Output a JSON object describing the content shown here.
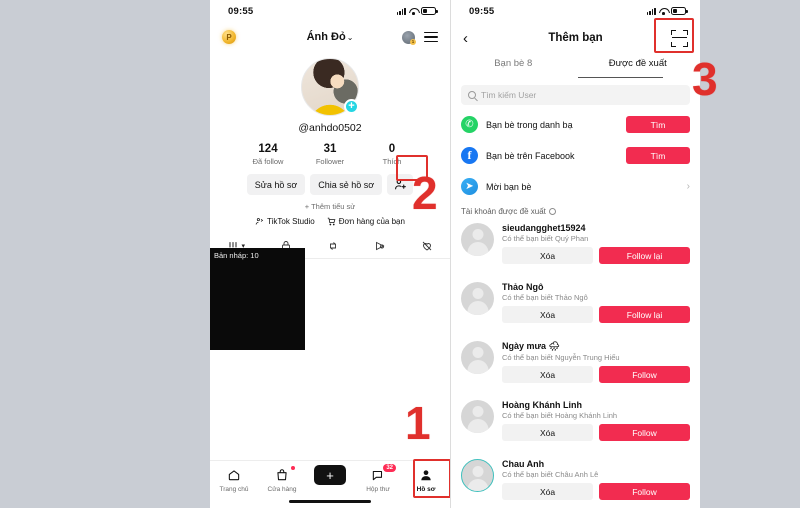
{
  "left_phone": {
    "status": {
      "time": "09:55"
    },
    "top": {
      "coin_label": "P",
      "profile_name": "Ánh Đỏ",
      "caret": "⌄",
      "avatar_badge": "1"
    },
    "profile": {
      "handle": "@anhdo0502",
      "avatar_plus": "+",
      "stats": [
        {
          "num": "124",
          "label": "Đã follow"
        },
        {
          "num": "31",
          "label": "Follower"
        },
        {
          "num": "0",
          "label": "Thích"
        }
      ],
      "edit_button": "Sửa hồ sơ",
      "share_button": "Chia sẻ hồ sơ",
      "add_friend_icon": "add-friend-icon",
      "add_bio": "+ Thêm tiểu sử",
      "links": [
        {
          "label": "TikTok Studio",
          "icon": "studio-icon"
        },
        {
          "label": "Đơn hàng của bạn",
          "icon": "cart-icon"
        }
      ]
    },
    "content_tabs": [
      {
        "icon": "grid-icon",
        "label": ""
      },
      {
        "icon": "lock-icon",
        "label": ""
      },
      {
        "icon": "repost-icon",
        "label": ""
      },
      {
        "icon": "tagged-icon",
        "label": ""
      },
      {
        "icon": "liked-icon",
        "label": ""
      }
    ],
    "draft": {
      "label": "Bản nháp: 10"
    },
    "bottom_nav": [
      {
        "label": "Trang chủ",
        "icon": "home-icon",
        "badge": ""
      },
      {
        "label": "Cửa hàng",
        "icon": "shop-icon",
        "badge": "dot"
      },
      {
        "label": "",
        "icon": "create-icon",
        "badge": ""
      },
      {
        "label": "Hộp thư",
        "icon": "inbox-icon",
        "badge": "32"
      },
      {
        "label": "Hồ sơ",
        "icon": "profile-icon",
        "badge": ""
      }
    ]
  },
  "right_phone": {
    "status": {
      "time": "09:55"
    },
    "header": {
      "back_icon": "back-chevron-icon",
      "title": "Thêm bạn",
      "scan_icon": "qr-scan-icon"
    },
    "tabs": [
      {
        "label": "Bạn bè 8",
        "active": false
      },
      {
        "label": "Được đề xuất",
        "active": true
      }
    ],
    "search": {
      "placeholder": "Tìm kiếm User",
      "icon": "search-icon"
    },
    "actions": [
      {
        "label": "Bạn bè trong danh bạ",
        "icon": "phone-contacts-icon",
        "button": "Tìm",
        "type": "button"
      },
      {
        "label": "Bạn bè trên Facebook",
        "icon": "facebook-icon",
        "button": "Tìm",
        "type": "button"
      },
      {
        "label": "Mời bạn bè",
        "icon": "invite-arrow-icon",
        "button": "›",
        "type": "chevron"
      }
    ],
    "section_title": "Tài khoản được đề xuất",
    "suggested": [
      {
        "name": "sieudangghet15924",
        "sub": "Có thể bạn biết Quý Phan",
        "delete": "Xóa",
        "follow": "Follow lại",
        "ring": false
      },
      {
        "name": "Thảo Ngô",
        "sub": "Có thể bạn biết Thảo Ngô",
        "delete": "Xóa",
        "follow": "Follow lại",
        "ring": false
      },
      {
        "name": "Ngày mưa 🌧",
        "sub": "Có thể bạn biết Nguyễn Trung Hiếu",
        "delete": "Xóa",
        "follow": "Follow",
        "ring": false
      },
      {
        "name": "Hoàng Khánh Linh",
        "sub": "Có thể bạn biết Hoàng Khánh Linh",
        "delete": "Xóa",
        "follow": "Follow",
        "ring": false
      },
      {
        "name": "Chau Anh",
        "sub": "Có thể bạn biết Châu Anh Lê",
        "delete": "Xóa",
        "follow": "Follow",
        "ring": true
      }
    ]
  },
  "annotations": [
    {
      "text": "1"
    },
    {
      "text": "2"
    },
    {
      "text": "3"
    }
  ],
  "colors": {
    "accent_red": "#f22c50",
    "annotation_red": "#e0302c",
    "cyan": "#25d6e3",
    "facebook_blue": "#1877f2",
    "whatsapp_green": "#25d366"
  }
}
